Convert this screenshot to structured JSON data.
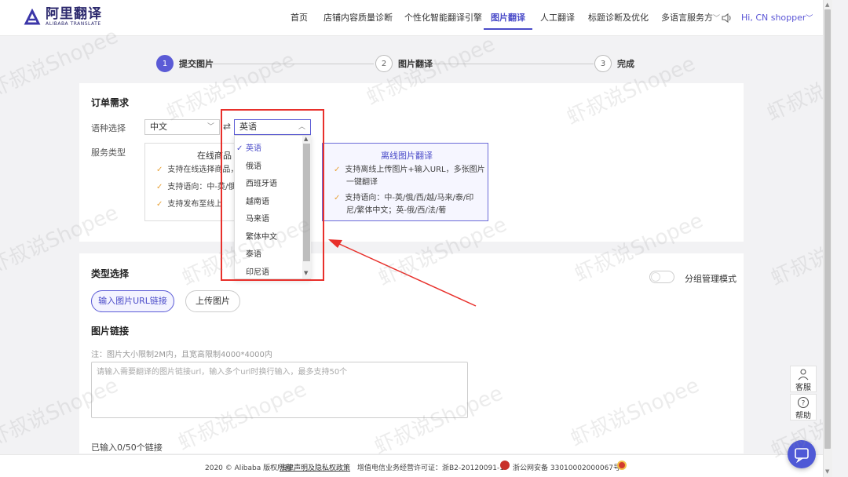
{
  "brand": {
    "name_cn": "阿里翻译",
    "name_en": "ALIBABA TRANSLATE"
  },
  "nav": {
    "items": [
      {
        "label": "首页"
      },
      {
        "label": "店铺内容质量诊断"
      },
      {
        "label": "个性化智能翻译引擎"
      },
      {
        "label": "图片翻译",
        "active": true
      },
      {
        "label": "人工翻译"
      },
      {
        "label": "标题诊断及优化"
      },
      {
        "label": "多语言服务方"
      }
    ],
    "user": "Hi, CN shopper"
  },
  "steps": [
    {
      "num": "1",
      "label": "提交图片",
      "active": true
    },
    {
      "num": "2",
      "label": "图片翻译"
    },
    {
      "num": "3",
      "label": "完成"
    }
  ],
  "order": {
    "title": "订单需求",
    "lang_label": "语种选择",
    "source_lang": "中文",
    "swap_symbol": "⇄",
    "target_lang": "英语",
    "service_label": "服务类型",
    "online": {
      "title": "在线商品",
      "lines": [
        "支持在线选择商品，",
        "支持语向：中-英/俄",
        "支持发布至线上"
      ]
    },
    "offline": {
      "title": "离线图片翻译",
      "lines": [
        "支持离线上传图片+输入URL，多张图片",
        "一键翻译",
        "支持语向：中-英/俄/西/越/马来/泰/印",
        "尼/繁体中文；英-俄/西/法/葡"
      ]
    }
  },
  "dropdown": {
    "options": [
      "英语",
      "俄语",
      "西班牙语",
      "越南语",
      "马来语",
      "繁体中文",
      "泰语",
      "印尼语"
    ],
    "selected": "英语"
  },
  "upload": {
    "title": "类型选择",
    "group_mode": "分组管理模式",
    "tab_url": "输入图片URL链接",
    "tab_upload": "上传图片",
    "link_title": "图片链接",
    "note": "注：图片大小限制2M内，且宽高限制4000*4000内",
    "placeholder": "请输入需要翻译的图片链接url，输入多个url时换行输入，最多支持50个",
    "count": "已输入0/50个链接"
  },
  "footer": {
    "copyright": "2020 © Alibaba 版权所有",
    "policy": "法律声明及隐私权政策",
    "icp": "增值电信业务经营许可证：浙B2-20120091-1",
    "police": "浙公网安备 33010002000067号"
  },
  "side": {
    "service": "客服",
    "help": "帮助"
  },
  "watermark": "虾叔说Shopee"
}
